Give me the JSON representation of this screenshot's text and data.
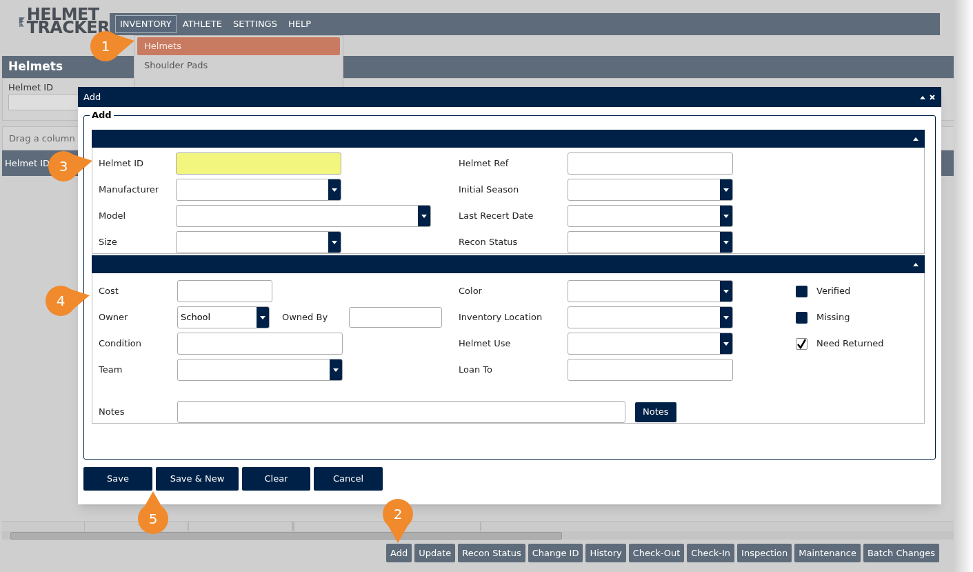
{
  "logo": {
    "line_1": "HELMET",
    "line_2": "TRACKER"
  },
  "nav": [
    {
      "label": "INVENTORY",
      "selected": true
    },
    {
      "label": "ATHLETE",
      "selected": false
    },
    {
      "label": "SETTINGS",
      "selected": false
    },
    {
      "label": "HELP",
      "selected": false
    }
  ],
  "inventory_menu": [
    {
      "label": "Helmets",
      "selected": true
    },
    {
      "label": "Shoulder Pads",
      "selected": false
    }
  ],
  "panel": {
    "title": "Helmets",
    "filter_label": "Helmet ID"
  },
  "grid": {
    "group_hint": "Drag a column",
    "first_column": "Helmet ID"
  },
  "toolbar": [
    "Add",
    "Update",
    "Recon Status",
    "Change ID",
    "History",
    "Check-Out",
    "Check-In",
    "Inspection",
    "Maintenance",
    "Batch Changes"
  ],
  "dialog": {
    "title": "Add",
    "legend": "Add",
    "section_1": {
      "left": [
        {
          "label": "Helmet ID",
          "kind": "text",
          "required": true
        },
        {
          "label": "Manufacturer",
          "kind": "select",
          "required": false
        },
        {
          "label": "Model",
          "kind": "select",
          "required": false
        },
        {
          "label": "Size",
          "kind": "select",
          "required": false
        }
      ],
      "right": [
        {
          "label": "Helmet Ref",
          "kind": "text",
          "required": false
        },
        {
          "label": "Initial Season",
          "kind": "select",
          "required": false
        },
        {
          "label": "Last Recert Date",
          "kind": "select",
          "required": false
        },
        {
          "label": "Recon Status",
          "kind": "select",
          "required": false
        }
      ]
    },
    "section_2": {
      "left": [
        {
          "label": "Cost",
          "kind": "text",
          "required": false
        },
        {
          "label": "Owner",
          "kind": "select",
          "required": false,
          "value": "School",
          "companion": {
            "label": "Owned By",
            "kind": "text"
          }
        },
        {
          "label": "Condition",
          "kind": "text",
          "required": false
        },
        {
          "label": "Team",
          "kind": "select",
          "required": false
        }
      ],
      "right": [
        {
          "label": "Color",
          "kind": "select",
          "required": false
        },
        {
          "label": "Inventory Location",
          "kind": "select",
          "required": false
        },
        {
          "label": "Helmet Use",
          "kind": "select",
          "required": false
        },
        {
          "label": "Loan To",
          "kind": "text",
          "required": false
        }
      ],
      "checks": [
        {
          "label": "Verified",
          "checked": false
        },
        {
          "label": "Missing",
          "checked": false
        },
        {
          "label": "Need Returned",
          "checked": true
        }
      ],
      "notes": {
        "label": "Notes",
        "button": "Notes"
      }
    },
    "buttons": [
      "Save",
      "Save & New",
      "Clear",
      "Cancel"
    ]
  },
  "callouts": [
    {
      "number": "1",
      "kind": "right"
    },
    {
      "number": "3",
      "kind": "right"
    },
    {
      "number": "4",
      "kind": "right"
    },
    {
      "number": "2",
      "kind": "down"
    },
    {
      "number": "5",
      "kind": "up"
    }
  ]
}
